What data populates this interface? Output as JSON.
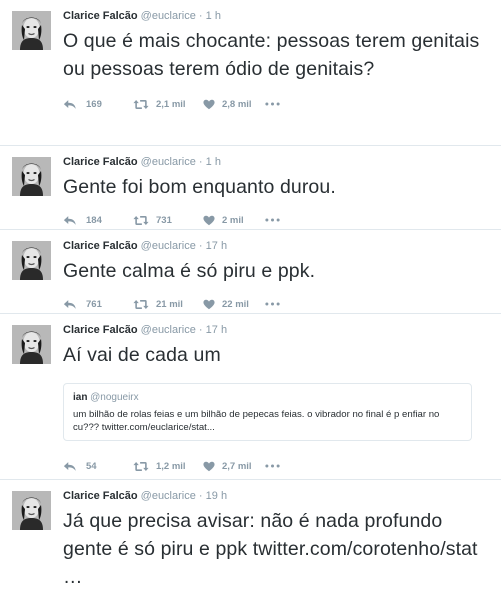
{
  "tweets": [
    {
      "name": "Clarice Falcão",
      "handle": "@euclarice",
      "sep": "·",
      "time": "1 h",
      "text": "O que é mais chocante: pessoas terem genitais ou pessoas terem ódio de genitais?",
      "replies": "169",
      "retweets": "2,1 mil",
      "likes": "2,8 mil"
    },
    {
      "name": "Clarice Falcão",
      "handle": "@euclarice",
      "sep": "·",
      "time": "1 h",
      "text": "Gente foi bom enquanto durou.",
      "replies": "184",
      "retweets": "731",
      "likes": "2 mil"
    },
    {
      "name": "Clarice Falcão",
      "handle": "@euclarice",
      "sep": "·",
      "time": "17 h",
      "text": "Gente calma é só piru e ppk.",
      "replies": "761",
      "retweets": "21 mil",
      "likes": "22 mil"
    },
    {
      "name": "Clarice Falcão",
      "handle": "@euclarice",
      "sep": "·",
      "time": "17 h",
      "text": "Aí vai de cada um",
      "quote": {
        "name": "ian",
        "handle": "@nogueirx",
        "text": "um bilhão de rolas feias e um bilhão de pepecas feias. o vibrador no final é p enfiar no cu??? twitter.com/euclarice/stat..."
      },
      "replies": "54",
      "retweets": "1,2 mil",
      "likes": "2,7 mil"
    },
    {
      "name": "Clarice Falcão",
      "handle": "@euclarice",
      "sep": "·",
      "time": "19 h",
      "text": "Já que precisa avisar: não é nada profundo gente é só piru e ppk",
      "link": "twitter.com/corotenho/stat …"
    }
  ],
  "icons": {
    "reply": "reply-icon",
    "retweet": "retweet-icon",
    "like": "heart-icon",
    "more": "more-icon"
  },
  "colors": {
    "muted": "#8899a6",
    "text": "#292f33",
    "border": "#e1e8ed"
  }
}
